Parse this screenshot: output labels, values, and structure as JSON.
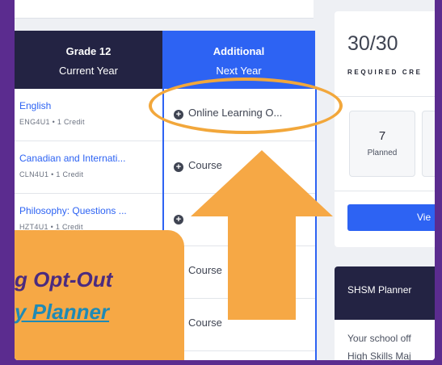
{
  "planner": {
    "grade_col": {
      "title": "Grade 12",
      "subtitle": "Current Year"
    },
    "additional_col": {
      "title": "Additional",
      "subtitle": "Next Year"
    },
    "courses": [
      {
        "title": "English",
        "meta": "ENG4U1 • 1 Credit"
      },
      {
        "title": "Canadian and Internati...",
        "meta": "CLN4U1 • 1 Credit"
      },
      {
        "title": "Philosophy: Questions ...",
        "meta": "HZT4U1 • 1 Credit"
      }
    ],
    "slots": [
      {
        "label": "Online Learning O..."
      },
      {
        "label": "Course"
      },
      {
        "label": ""
      },
      {
        "label": "Course"
      },
      {
        "label": "Course"
      }
    ]
  },
  "credits": {
    "value": "30/30",
    "label": "REQUIRED CRE",
    "stats": [
      {
        "number": "7",
        "label": "Planned"
      }
    ],
    "view_button": "Vie"
  },
  "shsm": {
    "title": "SHSM Planner",
    "text_line1": "Your school off",
    "text_line2": "High Skills Maj"
  },
  "callout": {
    "line1": "g Opt-Out",
    "line2": "y Planner"
  },
  "colors": {
    "frame": "#5b2c8f",
    "navy": "#232343",
    "blue": "#2d63f3",
    "annotation_orange": "#f2a73b"
  }
}
